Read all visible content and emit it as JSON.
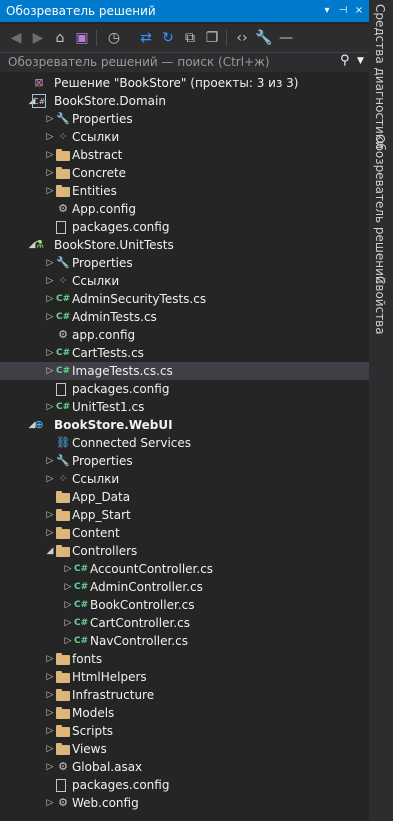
{
  "panel": {
    "title": "Обозреватель решений",
    "title_buttons": [
      "▾",
      "⊣",
      "×"
    ]
  },
  "toolbar": {
    "icons": [
      "back-icon",
      "forward-icon",
      "home-icon",
      "vs-icon",
      "history-icon",
      "sync-icon",
      "refresh-icon",
      "collapse-icon",
      "copy-icon",
      "code-icon",
      "wrench-icon",
      "dash-icon"
    ]
  },
  "search": {
    "placeholder": "Обозреватель решений — поиск (Ctrl+ж)",
    "icon": "search-icon"
  },
  "sidebar": {
    "tabs": [
      "Средства диагностики",
      "Обозреватель решений",
      "Свойства"
    ]
  },
  "tree": [
    {
      "label": "Решение \"BookStore\" (проекты: 3 из 3)",
      "level": 0,
      "expand": "none",
      "icon": "sln",
      "bold": false
    },
    {
      "label": "BookStore.Domain",
      "level": 0,
      "expand": "open",
      "icon": "proj",
      "bold": false
    },
    {
      "label": "Properties",
      "level": 1,
      "expand": "closed",
      "icon": "wrench",
      "bold": false
    },
    {
      "label": "Ссылки",
      "level": 1,
      "expand": "closed",
      "icon": "ref",
      "bold": false
    },
    {
      "label": "Abstract",
      "level": 1,
      "expand": "closed",
      "icon": "folder",
      "bold": false
    },
    {
      "label": "Concrete",
      "level": 1,
      "expand": "closed",
      "icon": "folder",
      "bold": false
    },
    {
      "label": "Entities",
      "level": 1,
      "expand": "closed",
      "icon": "folder",
      "bold": false
    },
    {
      "label": "App.config",
      "level": 1,
      "expand": "none",
      "icon": "config",
      "bold": false
    },
    {
      "label": "packages.config",
      "level": 1,
      "expand": "none",
      "icon": "file",
      "bold": false
    },
    {
      "label": "BookStore.UnitTests",
      "level": 0,
      "expand": "open",
      "icon": "test",
      "bold": false
    },
    {
      "label": "Properties",
      "level": 1,
      "expand": "closed",
      "icon": "wrench",
      "bold": false
    },
    {
      "label": "Ссылки",
      "level": 1,
      "expand": "closed",
      "icon": "ref",
      "bold": false
    },
    {
      "label": "AdminSecurityTests.cs",
      "level": 1,
      "expand": "closed",
      "icon": "cs",
      "bold": false
    },
    {
      "label": "AdminTests.cs",
      "level": 1,
      "expand": "closed",
      "icon": "cs",
      "bold": false
    },
    {
      "label": "app.config",
      "level": 1,
      "expand": "none",
      "icon": "config",
      "bold": false
    },
    {
      "label": "CartTests.cs",
      "level": 1,
      "expand": "closed",
      "icon": "cs",
      "bold": false
    },
    {
      "label": "ImageTests.cs.cs",
      "level": 1,
      "expand": "closed",
      "icon": "cs",
      "bold": false,
      "selected": true
    },
    {
      "label": "packages.config",
      "level": 1,
      "expand": "none",
      "icon": "file",
      "bold": false
    },
    {
      "label": "UnitTest1.cs",
      "level": 1,
      "expand": "closed",
      "icon": "cs",
      "bold": false
    },
    {
      "label": "BookStore.WebUI",
      "level": 0,
      "expand": "open",
      "icon": "web",
      "bold": true
    },
    {
      "label": "Connected Services",
      "level": 1,
      "expand": "none",
      "icon": "svc",
      "bold": false
    },
    {
      "label": "Properties",
      "level": 1,
      "expand": "closed",
      "icon": "wrench",
      "bold": false
    },
    {
      "label": "Ссылки",
      "level": 1,
      "expand": "closed",
      "icon": "ref",
      "bold": false
    },
    {
      "label": "App_Data",
      "level": 1,
      "expand": "none",
      "icon": "folder",
      "bold": false
    },
    {
      "label": "App_Start",
      "level": 1,
      "expand": "closed",
      "icon": "folder",
      "bold": false
    },
    {
      "label": "Content",
      "level": 1,
      "expand": "closed",
      "icon": "folder",
      "bold": false
    },
    {
      "label": "Controllers",
      "level": 1,
      "expand": "open",
      "icon": "folder",
      "bold": false
    },
    {
      "label": "AccountController.cs",
      "level": 2,
      "expand": "closed",
      "icon": "cs",
      "bold": false
    },
    {
      "label": "AdminController.cs",
      "level": 2,
      "expand": "closed",
      "icon": "cs",
      "bold": false
    },
    {
      "label": "BookController.cs",
      "level": 2,
      "expand": "closed",
      "icon": "cs",
      "bold": false
    },
    {
      "label": "CartController.cs",
      "level": 2,
      "expand": "closed",
      "icon": "cs",
      "bold": false
    },
    {
      "label": "NavController.cs",
      "level": 2,
      "expand": "closed",
      "icon": "cs",
      "bold": false
    },
    {
      "label": "fonts",
      "level": 1,
      "expand": "closed",
      "icon": "folder",
      "bold": false
    },
    {
      "label": "HtmlHelpers",
      "level": 1,
      "expand": "closed",
      "icon": "folder",
      "bold": false
    },
    {
      "label": "Infrastructure",
      "level": 1,
      "expand": "closed",
      "icon": "folder",
      "bold": false
    },
    {
      "label": "Models",
      "level": 1,
      "expand": "closed",
      "icon": "folder",
      "bold": false
    },
    {
      "label": "Scripts",
      "level": 1,
      "expand": "closed",
      "icon": "folder",
      "bold": false
    },
    {
      "label": "Views",
      "level": 1,
      "expand": "closed",
      "icon": "folder",
      "bold": false
    },
    {
      "label": "Global.asax",
      "level": 1,
      "expand": "closed",
      "icon": "gear",
      "bold": false
    },
    {
      "label": "packages.config",
      "level": 1,
      "expand": "none",
      "icon": "file",
      "bold": false
    },
    {
      "label": "Web.config",
      "level": 1,
      "expand": "closed",
      "icon": "config",
      "bold": false
    }
  ]
}
